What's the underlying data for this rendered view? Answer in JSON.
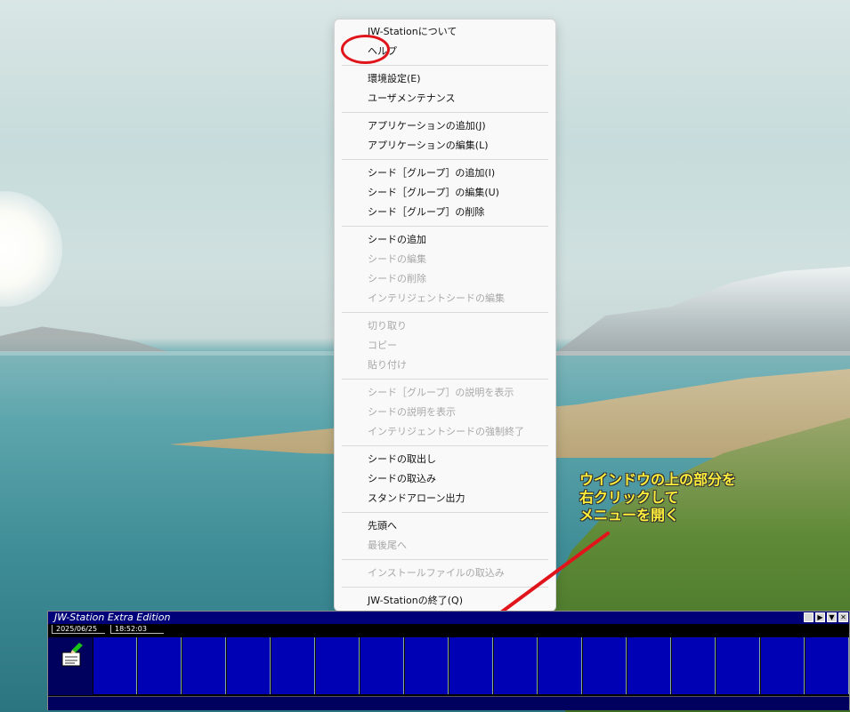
{
  "menu": {
    "items": [
      {
        "label": "JW-Stationについて",
        "enabled": true
      },
      {
        "label": "ヘルプ",
        "enabled": true
      },
      {
        "label": "環境設定(E)",
        "enabled": true
      },
      {
        "label": "ユーザメンテナンス",
        "enabled": true
      },
      {
        "label": "アプリケーションの追加(J)",
        "enabled": true
      },
      {
        "label": "アプリケーションの編集(L)",
        "enabled": true
      },
      {
        "label": "シード［グループ］の追加(I)",
        "enabled": true
      },
      {
        "label": "シード［グループ］の編集(U)",
        "enabled": true
      },
      {
        "label": "シード［グループ］の削除",
        "enabled": true
      },
      {
        "label": "シードの追加",
        "enabled": true
      },
      {
        "label": "シードの編集",
        "enabled": false
      },
      {
        "label": "シードの削除",
        "enabled": false
      },
      {
        "label": "インテリジェントシードの編集",
        "enabled": false
      },
      {
        "label": "切り取り",
        "enabled": false
      },
      {
        "label": "コピー",
        "enabled": false
      },
      {
        "label": "貼り付け",
        "enabled": false
      },
      {
        "label": "シード［グループ］の説明を表示",
        "enabled": false
      },
      {
        "label": "シードの説明を表示",
        "enabled": false
      },
      {
        "label": "インテリジェントシードの強制終了",
        "enabled": false
      },
      {
        "label": "シードの取出し",
        "enabled": true
      },
      {
        "label": "シードの取込み",
        "enabled": true
      },
      {
        "label": "スタンドアローン出力",
        "enabled": true
      },
      {
        "label": "先頭へ",
        "enabled": true
      },
      {
        "label": "最後尾へ",
        "enabled": false
      },
      {
        "label": "インストールファイルの取込み",
        "enabled": false
      },
      {
        "label": "JW-Stationの終了(Q)",
        "enabled": true
      }
    ]
  },
  "annotation": {
    "line1": "ウインドウの上の部分を",
    "line2": "右クリックして",
    "line3": "メニューを開く",
    "text_color": "#ffef3a",
    "highlight_color": "#e0141b"
  },
  "jw": {
    "title": "JW-Station Extra Edition",
    "date": "2025/06/25",
    "time": "18:52:03",
    "titlebar_color": "#000078",
    "slot_color": "#0000b5",
    "buttons": [
      {
        "icon": "minimize-icon"
      },
      {
        "icon": "play-icon"
      },
      {
        "icon": "triangle-down-icon"
      },
      {
        "icon": "close-icon"
      }
    ]
  }
}
